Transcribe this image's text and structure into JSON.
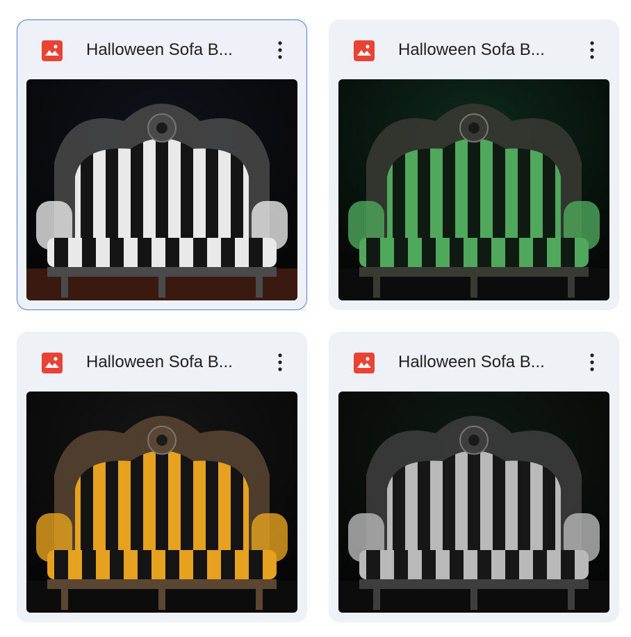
{
  "files": [
    {
      "title": "Halloween Sofa B...",
      "icon": "image-file-icon",
      "selected": true,
      "theme": "black-white",
      "colors": {
        "stripeA": "#e9e9e9",
        "stripeB": "#141414",
        "bg": "#10121b",
        "frame": "#4a4a4a"
      }
    },
    {
      "title": "Halloween Sofa B...",
      "icon": "image-file-icon",
      "selected": false,
      "theme": "green-black",
      "colors": {
        "stripeA": "#4fa85c",
        "stripeB": "#0f1a12",
        "bg": "#0d2a1a",
        "frame": "#3a3a34"
      }
    },
    {
      "title": "Halloween Sofa B...",
      "icon": "image-file-icon",
      "selected": false,
      "theme": "yellow-black",
      "colors": {
        "stripeA": "#e6a21f",
        "stripeB": "#141414",
        "bg": "#151515",
        "frame": "#5a4632"
      }
    },
    {
      "title": "Halloween Sofa B...",
      "icon": "image-file-icon",
      "selected": false,
      "theme": "grey-black",
      "colors": {
        "stripeA": "#b9b9b9",
        "stripeB": "#171717",
        "bg": "#0f1913",
        "frame": "#3e3e3e"
      }
    }
  ],
  "accent": "#4f7fd9",
  "icon_color": "#ea4335"
}
